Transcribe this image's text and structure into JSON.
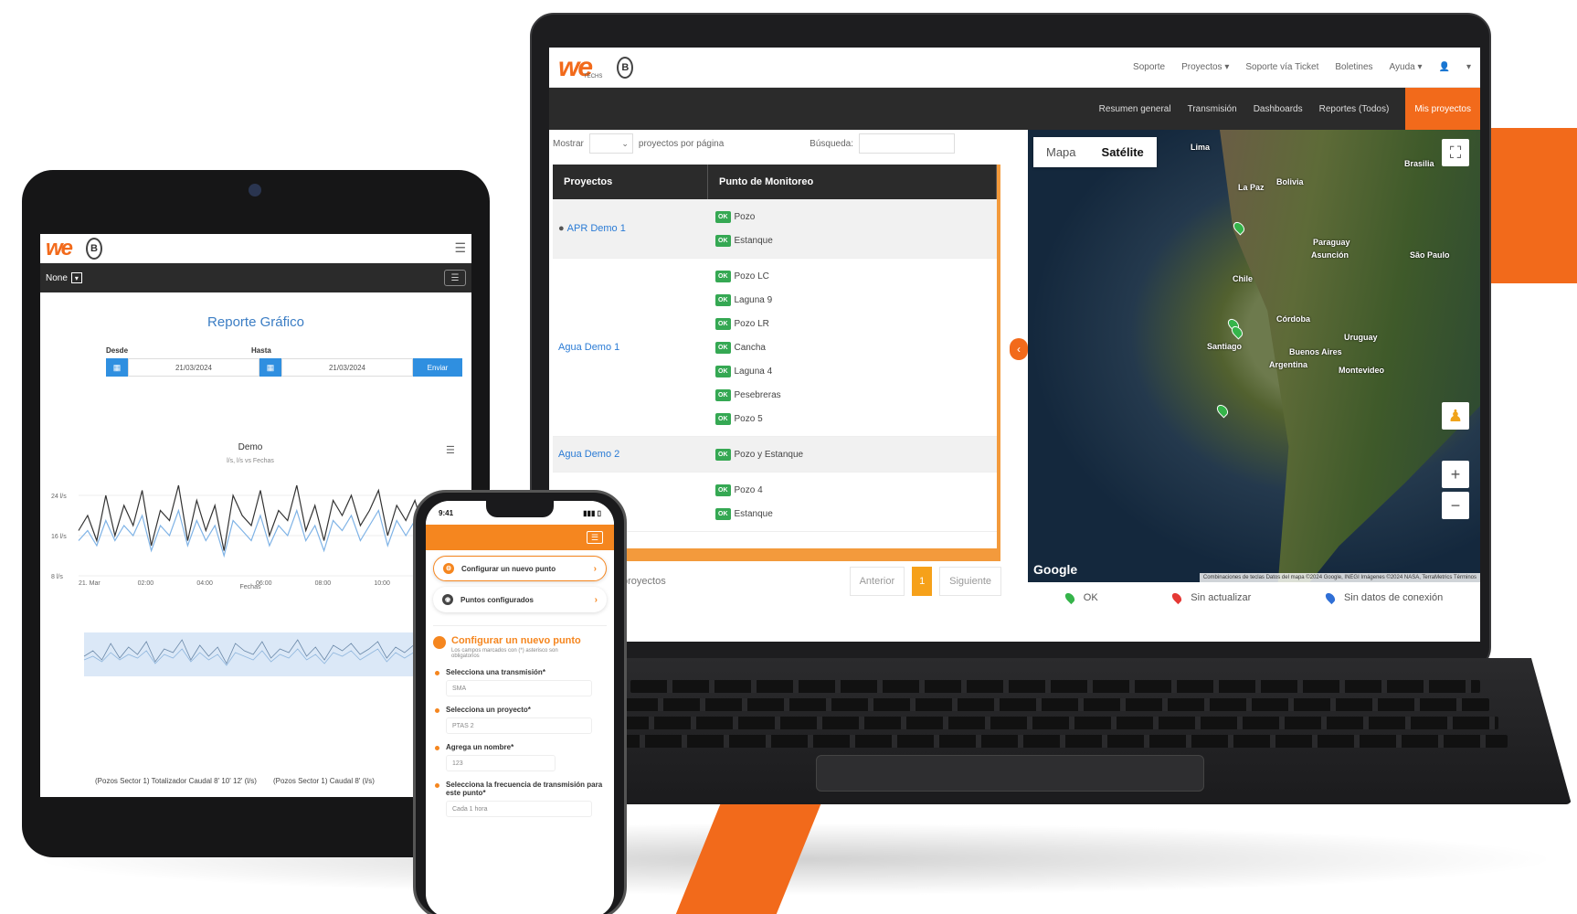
{
  "brand": {
    "logo": "we",
    "logo_sub": "TECHS",
    "seal": "B",
    "accent": "#f26a1b"
  },
  "laptop": {
    "top_nav": [
      "Soporte",
      "Proyectos ▾",
      "Soporte vía Ticket",
      "Boletines",
      "Ayuda ▾",
      "▾"
    ],
    "sub_nav": [
      "Resumen general",
      "Transmisión",
      "Dashboards",
      "Reportes (Todos)",
      "Mis proyectos"
    ],
    "table_controls": {
      "show_label": "Mostrar",
      "per_page_label": "proyectos por página",
      "search_label": "Búsqueda:"
    },
    "table_headers": [
      "Proyectos",
      "Punto de Monitoreo"
    ],
    "rows": [
      {
        "project": "APR Demo 1",
        "points": [
          "Pozo",
          "Estanque"
        ]
      },
      {
        "project": "Agua Demo 1",
        "points": [
          "Pozo LC",
          "Laguna 9",
          "Pozo LR",
          "Cancha",
          "Laguna 4",
          "Pesebreras",
          "Pozo 5"
        ]
      },
      {
        "project": "Agua Demo 2",
        "points": [
          "Pozo y Estanque"
        ]
      },
      {
        "project": "",
        "points": [
          "Pozo 4",
          "Estanque"
        ]
      }
    ],
    "ok_badge": "OK",
    "pager": {
      "info": "proyectos",
      "prev": "Anterior",
      "page": "1",
      "next": "Siguiente"
    },
    "map": {
      "tabs": [
        "Mapa",
        "Satélite"
      ],
      "labels": [
        "Lima",
        "Bolivia",
        "Paraguay",
        "Asunción",
        "Chile",
        "Córdoba",
        "Santiago",
        "Buenos Aires",
        "Argentina",
        "Uruguay",
        "Montevideo",
        "Brasilia",
        "La Paz",
        "São Paulo"
      ],
      "google": "Google",
      "attribution": "Combinaciones de teclas  Datos del mapa ©2024 Google, INEGI Imágenes ©2024 NASA, TerraMetrics  Términos"
    },
    "legend": [
      "OK",
      "Sin actualizar",
      "Sin datos de conexión"
    ]
  },
  "tablet": {
    "filter_label": "None",
    "title": "Reporte Gráfico",
    "from_label": "Desde",
    "to_label": "Hasta",
    "from_date": "21/03/2024",
    "to_date": "21/03/2024",
    "send_label": "Enviar",
    "chart_title": "Demo",
    "chart_subtitle": "l/s, l/s vs Fechas",
    "y_ticks": [
      "24 l/s",
      "16 l/s",
      "8 l/s"
    ],
    "x_ticks": [
      "21. Mar",
      "02:00",
      "04:00",
      "06:00",
      "08:00",
      "10:00"
    ],
    "x_label": "Fechas",
    "legend": [
      "(Pozos Sector 1) Totalizador Caudal 8' 10' 12'  (l/s)",
      "(Pozos Sector 1) Caudal 8'  (l/s)"
    ]
  },
  "phone": {
    "time": "9:41",
    "menu_items": [
      "Configurar un nuevo punto",
      "Puntos configurados"
    ],
    "form_title": "Configurar un nuevo punto",
    "form_subtitle": "Los campos marcados con (*) asterisco son obligatorios",
    "fields": [
      {
        "label": "Selecciona una transmisión*",
        "value": "SMA"
      },
      {
        "label": "Selecciona un proyecto*",
        "value": "PTAS 2"
      },
      {
        "label": "Agrega un nombre*",
        "value": "123"
      },
      {
        "label": "Selecciona la frecuencia de transmisión para este punto*",
        "value": "Cada 1 hora"
      }
    ]
  },
  "chart_data": {
    "type": "line",
    "title": "Demo",
    "subtitle": "l/s, l/s vs Fechas",
    "xlabel": "Fechas",
    "categories": [
      "21. Mar",
      "02:00",
      "04:00",
      "06:00",
      "08:00",
      "10:00"
    ],
    "ylim": [
      8,
      28
    ],
    "series": [
      {
        "name": "(Pozos Sector 1) Totalizador Caudal 8' 10' 12'  (l/s)",
        "color": "#333333",
        "values": [
          17,
          20,
          15,
          24,
          16,
          22,
          18,
          25,
          14,
          21,
          19,
          26,
          15,
          23,
          17,
          22,
          13,
          24,
          20,
          18,
          25,
          16,
          21,
          19,
          26,
          17,
          22,
          15,
          23,
          20,
          24,
          18,
          21,
          25,
          16,
          22,
          19,
          23,
          17,
          21
        ]
      },
      {
        "name": "(Pozos Sector 1) Caudal 8'  (l/s)",
        "color": "#7fb3e6",
        "values": [
          15,
          17,
          14,
          19,
          15,
          18,
          16,
          20,
          13,
          18,
          16,
          21,
          14,
          19,
          15,
          18,
          12,
          19,
          17,
          15,
          20,
          14,
          18,
          16,
          21,
          15,
          18,
          13,
          19,
          17,
          20,
          15,
          18,
          21,
          14,
          19,
          16,
          19,
          15,
          18
        ]
      }
    ]
  }
}
